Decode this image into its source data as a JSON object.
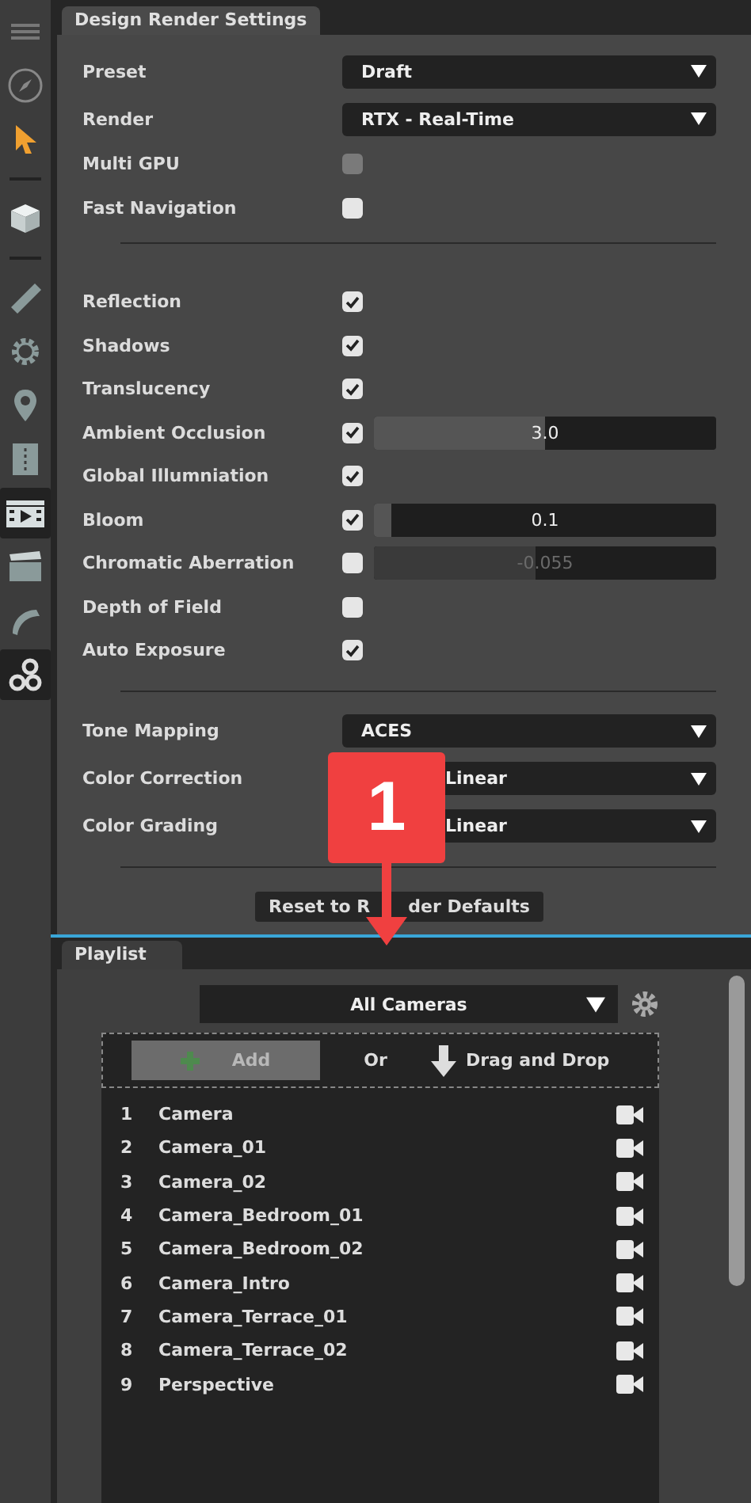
{
  "sidebar": {
    "tools": [
      {
        "kind": "menu",
        "selected": false
      },
      {
        "kind": "compass",
        "selected": false
      },
      {
        "kind": "cursor",
        "selected": false
      },
      {
        "kind": "separator"
      },
      {
        "kind": "cube",
        "selected": false
      },
      {
        "kind": "separator"
      },
      {
        "kind": "ruler",
        "selected": false
      },
      {
        "kind": "gear",
        "selected": false
      },
      {
        "kind": "pin",
        "selected": false
      },
      {
        "kind": "book",
        "selected": false
      },
      {
        "kind": "film",
        "selected": true
      },
      {
        "kind": "clapper",
        "selected": false
      },
      {
        "kind": "brush",
        "selected": false
      },
      {
        "kind": "gears",
        "selected": true
      }
    ]
  },
  "render_settings": {
    "tab": "Design Render Settings",
    "groups": [
      [
        {
          "kind": "dropdown",
          "label": "Preset",
          "value": "Draft"
        },
        {
          "kind": "dropdown",
          "label": "Render",
          "value": "RTX - Real-Time"
        },
        {
          "kind": "checkbox",
          "label": "Multi GPU",
          "checked": false,
          "disabled": true
        },
        {
          "kind": "checkbox",
          "label": "Fast Navigation",
          "checked": false,
          "disabled": false
        }
      ],
      [
        {
          "kind": "checkbox",
          "label": "Reflection",
          "checked": true,
          "disabled": false
        },
        {
          "kind": "checkbox",
          "label": "Shadows",
          "checked": true,
          "disabled": false
        },
        {
          "kind": "checkbox",
          "label": "Translucency",
          "checked": true,
          "disabled": false
        },
        {
          "kind": "slider",
          "label": "Ambient Occlusion",
          "checked": true,
          "disabled": false,
          "level": 0.5,
          "reading": "3.0"
        },
        {
          "kind": "checkbox",
          "label": "Global Illumniation",
          "checked": true,
          "disabled": false
        },
        {
          "kind": "slider",
          "label": "Bloom",
          "checked": true,
          "disabled": false,
          "level": 0.05,
          "reading": "0.1"
        },
        {
          "kind": "slider",
          "label": "Chromatic Aberration",
          "checked": false,
          "disabled": false,
          "level": 0.47,
          "reading": "-0.055"
        },
        {
          "kind": "checkbox",
          "label": "Depth of Field",
          "checked": false,
          "disabled": false
        },
        {
          "kind": "checkbox",
          "label": "Auto Exposure",
          "checked": true,
          "disabled": false
        }
      ],
      [
        {
          "kind": "dropdown",
          "label": "Tone Mapping",
          "value": "ACES"
        },
        {
          "kind": "dropdown",
          "label": "Color Correction",
          "value": "Linear"
        },
        {
          "kind": "dropdown",
          "label": "Color Grading",
          "value": "Linear"
        }
      ]
    ],
    "reset_button": "Reset to R",
    "reset_button_tail": "der Defaults"
  },
  "callout": {
    "label": "1"
  },
  "playlist": {
    "tab": "Playlist",
    "filter": "All Cameras",
    "add_button": {
      "label": "Add",
      "disabled": true
    },
    "or": "Or",
    "drop_hint": "Drag and Drop",
    "cameras": [
      {
        "number": "1",
        "name": "Camera"
      },
      {
        "number": "2",
        "name": "Camera_01"
      },
      {
        "number": "3",
        "name": "Camera_02"
      },
      {
        "number": "4",
        "name": "Camera_Bedroom_01"
      },
      {
        "number": "5",
        "name": "Camera_Bedroom_02"
      },
      {
        "number": "6",
        "name": "Camera_Intro"
      },
      {
        "number": "7",
        "name": "Camera_Terrace_01"
      },
      {
        "number": "8",
        "name": "Camera_Terrace_02"
      },
      {
        "number": "9",
        "name": "Perspective"
      }
    ]
  }
}
